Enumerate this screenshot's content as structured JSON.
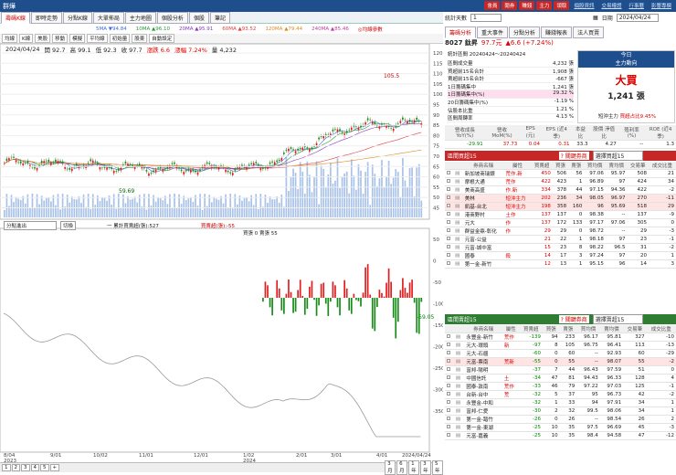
{
  "app": {
    "title": "群燁",
    "top_buttons": [
      "會員",
      "閱券",
      "賺錢",
      "主力",
      "領取"
    ],
    "top_links": [
      "個股資訊",
      "交易權證",
      "行事曆",
      "影響專欄"
    ]
  },
  "tabs": [
    "壽碼K線",
    "即時走勢",
    "分點K線",
    "大單佈局",
    "主力地圖",
    "個股分析",
    "個股",
    "筆記"
  ],
  "indicators": {
    "ma5": "5MA ▼94.84",
    "ma10": "10MA ▲96.10",
    "ma20": "20MA ▲95.91",
    "ma60": "60MA ▲93.52",
    "ma120": "120MA ▲79.44",
    "ma240": "240MA ▲85.46",
    "ma_note": "◎均線參數"
  },
  "toolbar": [
    "均線",
    "K線",
    "美股",
    "移動",
    "模擬",
    "平均線",
    "初始量",
    "股東",
    "自動設定"
  ],
  "quote": {
    "date": "2024/04/24",
    "open": "開 92.7",
    "high": "高 99.1",
    "low": "低 92.3",
    "close": "收 97.7",
    "chg": "漲跌 6.6",
    "pct": "漲幅 7.24%",
    "vol": "量 4,232"
  },
  "price_axis": [
    "120",
    "115",
    "110",
    "105",
    "100",
    "95",
    "90",
    "85",
    "80",
    "75",
    "70",
    "65",
    "60",
    "55",
    "50",
    "45"
  ],
  "peak_label": "105.5",
  "low_label": "59.69",
  "date_axis": [
    "8/04",
    "9/01",
    "10/02",
    "11/01",
    "12/01",
    "1/02",
    "2/01",
    "3/01",
    "4/01",
    "2024/04/24"
  ],
  "year_labels": [
    "2023",
    "2024"
  ],
  "sub": {
    "select": "分點進出",
    "btn": "切換",
    "legend": "一 累計買賣超(張):527",
    "legend2": "買賣超(張):-55",
    "legend3": "買張 0 賣張 55",
    "current": "-59.05",
    "axis": [
      "50",
      "0",
      "-50",
      "-100",
      "-150",
      "-200",
      "-250",
      "-300",
      "-350"
    ]
  },
  "bottom": {
    "pages": [
      "1",
      "2",
      "3",
      "4",
      "5",
      "+"
    ],
    "periods": [
      "3月",
      "6月",
      "1年",
      "3年",
      "5年"
    ]
  },
  "right": {
    "toolbar": {
      "label": "統計天數",
      "days": "1",
      "date_label": "日期",
      "date": "2024/04/24"
    },
    "tabs": [
      "籌碼分析",
      "重大事件",
      "分點分析",
      "賺錢報表",
      "法人買賣"
    ],
    "stock": {
      "code": "8027 鈦昇",
      "price": "97.7元",
      "chg": "▲6.6 (+7.24%)"
    },
    "stats_title": "統計區間 20240424～20240424",
    "stats": [
      [
        "區間成交量",
        "4,232 張"
      ],
      [
        "買超前15名合計",
        "1,908 張"
      ],
      [
        "賣超前15名合計",
        "-667 張"
      ],
      [
        "1日籌碼集中",
        "1,241 張"
      ],
      [
        "1日籌碼集中(%)",
        "29.32 %"
      ],
      [
        "20日籌碼集中(%)",
        "-1.19 %"
      ],
      [
        "佔股本比重",
        "1.21 %"
      ],
      [
        "區間周轉率",
        "4.13 %"
      ]
    ],
    "today": {
      "label": "今日",
      "sub": "主力動向",
      "big": "大買",
      "qty": "1,241 張",
      "short": "短沖主力",
      "short_val": "買超占比9.45%"
    },
    "metrics": {
      "heads": [
        "營收成長 YoY(%)",
        "營收 MoM(%)",
        "EPS (元)",
        "EPS (近4季)",
        "本益比",
        "股價 淨值比",
        "殖利率 (%)",
        "ROE (近4季)"
      ],
      "vals": [
        "-29.91",
        "37.73",
        "0.04",
        "0.31",
        "33.3",
        "4.27",
        "--",
        "1.3"
      ]
    },
    "buy": {
      "title": "區間買超15",
      "btn": "? 關鍵券商",
      "select": "選擇買超15",
      "heads": [
        "",
        "",
        "券商名稱",
        "屬性",
        "買賣超",
        "買張",
        "賣張",
        "買均價",
        "賣均價",
        "交易筆",
        "成交比重"
      ],
      "rows": [
        [
          "新加坡商瑞銀",
          "荒作.新",
          "450",
          "506",
          "56",
          "97.06",
          "95.97",
          "508",
          "21"
        ],
        [
          "摩根大通",
          "荒作",
          "422",
          "423",
          "1",
          "96.89",
          "97",
          "424",
          "34"
        ],
        [
          "美商高盛",
          "作.新",
          "334",
          "378",
          "44",
          "97.15",
          "94.36",
          "422",
          "-2"
        ],
        [
          "美林",
          "短沖主力",
          "202",
          "236",
          "34",
          "98.05",
          "96.97",
          "270",
          "-11"
        ],
        [
          "凱基-台北",
          "短沖主力",
          "198",
          "358",
          "160",
          "96",
          "95.69",
          "518",
          "29"
        ],
        [
          "港商野村",
          "土作",
          "137",
          "137",
          "0",
          "98.38",
          "--",
          "137",
          "-9"
        ],
        [
          "元大",
          "作",
          "137",
          "172",
          "133",
          "97.17",
          "97.06",
          "305",
          "0"
        ],
        [
          "群益金鼎-彰化",
          "作",
          "29",
          "29",
          "0",
          "98.72",
          "--",
          "29",
          "-3"
        ],
        [
          "元富-公益",
          "",
          "21",
          "22",
          "1",
          "98.18",
          "97",
          "23",
          "-1"
        ],
        [
          "元富-城中富",
          "",
          "15",
          "23",
          "8",
          "98.22",
          "96.5",
          "31",
          "-2"
        ],
        [
          "國泰",
          "殺",
          "14",
          "17",
          "3",
          "97.24",
          "97",
          "20",
          "1"
        ],
        [
          "第一金-新竹",
          "",
          "12",
          "13",
          "1",
          "95.15",
          "96",
          "14",
          "3"
        ]
      ]
    },
    "sell": {
      "title": "區間賣超15",
      "btn": "? 關鍵券商",
      "select": "選擇賣超15",
      "heads": [
        "",
        "",
        "券商名稱",
        "屬性",
        "買賣超",
        "買張",
        "賣張",
        "買均價",
        "賣均價",
        "交易筆",
        "成交比重"
      ],
      "rows": [
        [
          "永豐金-新竹",
          "荒作",
          "-139",
          "94",
          "233",
          "96.17",
          "95.81",
          "327",
          "-10"
        ],
        [
          "元大-環頭",
          "新",
          "-97",
          "8",
          "105",
          "96.75",
          "96.41",
          "113",
          "-13"
        ],
        [
          "元大-石疆",
          "",
          "-60",
          "0",
          "60",
          "--",
          "92.93",
          "60",
          "-29"
        ],
        [
          "元富-票南",
          "荒新",
          "-55",
          "0",
          "55",
          "--",
          "98.07",
          "55",
          "-2"
        ],
        [
          "富邦-陽明",
          "",
          "-37",
          "7",
          "44",
          "96.43",
          "97.59",
          "51",
          "0"
        ],
        [
          "中國信託",
          "土",
          "-34",
          "47",
          "81",
          "94.43",
          "96.33",
          "128",
          "4"
        ],
        [
          "國泰-敦南",
          "荒作",
          "-33",
          "46",
          "79",
          "97.22",
          "97.03",
          "125",
          "-1"
        ],
        [
          "台新-台中",
          "荒",
          "-32",
          "5",
          "37",
          "95",
          "96.73",
          "42",
          "-2"
        ],
        [
          "永豐金-中和",
          "",
          "-32",
          "1",
          "33",
          "94",
          "97.91",
          "34",
          "1"
        ],
        [
          "富邦-仁愛",
          "",
          "-30",
          "2",
          "32",
          "99.5",
          "98.06",
          "34",
          "1"
        ],
        [
          "第一金-踏竹",
          "",
          "-26",
          "0",
          "26",
          "--",
          "98.54",
          "26",
          "2"
        ],
        [
          "第一金-東湖",
          "",
          "-25",
          "10",
          "35",
          "97.5",
          "96.69",
          "45",
          "-3"
        ],
        [
          "元富-嘉義",
          "",
          "-25",
          "10",
          "35",
          "98.4",
          "94.58",
          "47",
          "-12"
        ]
      ]
    }
  }
}
